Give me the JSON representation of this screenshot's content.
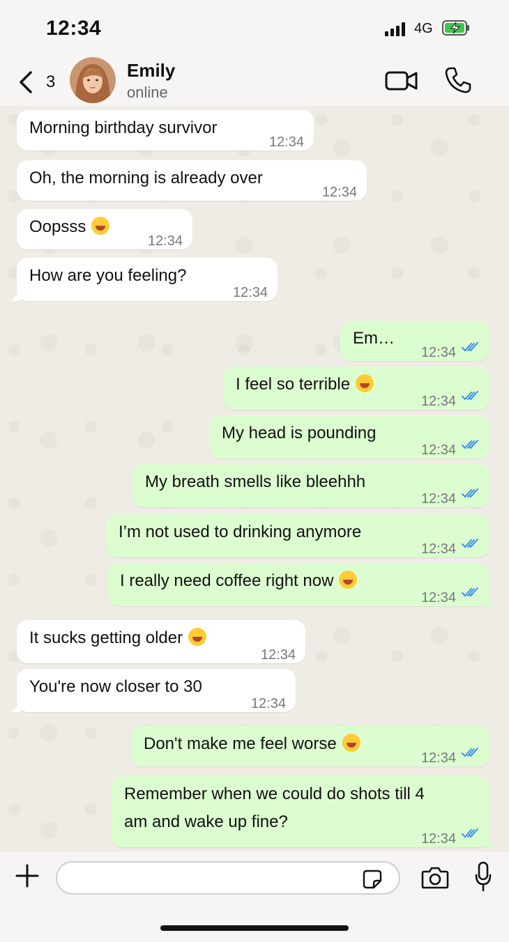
{
  "status": {
    "time": "12:34",
    "network": "4G"
  },
  "header": {
    "back_count": "3",
    "contact_name": "Emily",
    "presence": "online"
  },
  "messages": [
    {
      "dir": "in",
      "text": "Morning birthday survivor",
      "time": "12:34"
    },
    {
      "dir": "in",
      "text": "Oh, the morning is already over",
      "time": "12:34"
    },
    {
      "dir": "in",
      "text": "Oopsss",
      "time": "12:34",
      "emoji": "laughing-emoji"
    },
    {
      "dir": "in",
      "text": "How are you feeling?",
      "time": "12:34"
    },
    {
      "dir": "out",
      "text": "Em…",
      "time": "12:34",
      "read": true
    },
    {
      "dir": "out",
      "text": "I feel so terrible",
      "time": "12:34",
      "read": true,
      "emoji": "woozy-emoji"
    },
    {
      "dir": "out",
      "text": "My head is pounding",
      "time": "12:34",
      "read": true
    },
    {
      "dir": "out",
      "text": "My breath smells like bleehhh",
      "time": "12:34",
      "read": true
    },
    {
      "dir": "out",
      "text": "I’m not used to drinking anymore",
      "time": "12:34",
      "read": true
    },
    {
      "dir": "out",
      "text": "I really need coffee right now",
      "time": "12:34",
      "read": true,
      "emoji": "tired-emoji"
    },
    {
      "dir": "in",
      "text": "It sucks getting older",
      "time": "12:34",
      "emoji": "sweat-smile-emoji"
    },
    {
      "dir": "in",
      "text": "You're now closer to 30",
      "time": "12:34"
    },
    {
      "dir": "out",
      "text": "Don't make me feel worse",
      "time": "12:34",
      "read": true,
      "emoji": "laughing-emoji"
    },
    {
      "dir": "out",
      "text": "Remember when we could do shots till 4",
      "text2": "am and wake up fine?",
      "time": "12:34",
      "read": true
    }
  ],
  "colors": {
    "incoming": "#ffffff",
    "outgoing": "#dcfdd0",
    "tick": "#3a8ef0"
  }
}
